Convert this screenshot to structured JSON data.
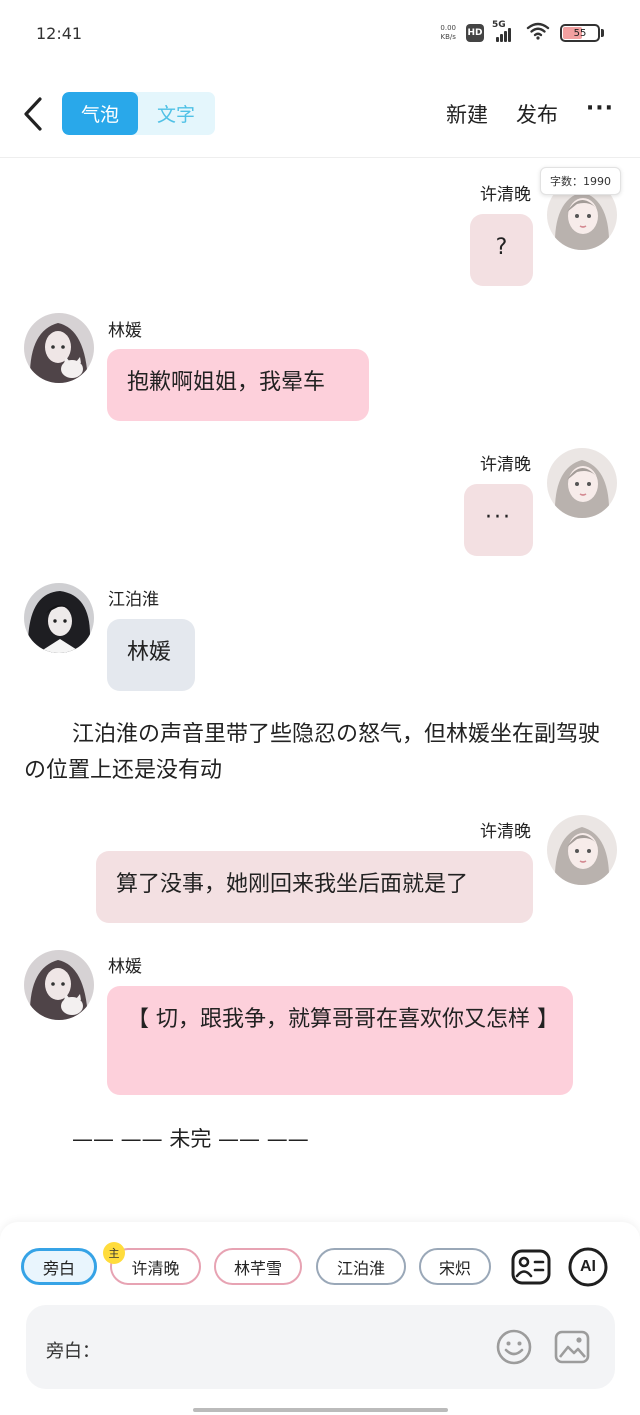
{
  "status_bar": {
    "time": "12:41",
    "net_speed_value": "0.00",
    "net_speed_unit": "KB/s",
    "hd_label": "HD",
    "signal_label": "5G",
    "battery_level": "55",
    "battery_fraction": 0.55
  },
  "header": {
    "tab_bubble": "气泡",
    "tab_text": "文字",
    "active_tab": "气泡",
    "new_label": "新建",
    "publish_label": "发布",
    "more_label": "···"
  },
  "word_count": "字数：1990",
  "messages": [
    {
      "speaker": "许清晚",
      "side": "right",
      "text": "?",
      "avatar": "female-avatar-icon"
    },
    {
      "speaker": "林媛",
      "side": "left",
      "text": "抱歉啊姐姐，我晕车",
      "avatar": "girl-with-cat-avatar-icon"
    },
    {
      "speaker": "许清晚",
      "side": "right",
      "text": "···",
      "avatar": "female-avatar-icon"
    },
    {
      "speaker": "江泊淮",
      "side": "left",
      "text": "林媛",
      "avatar": "dark-haired-male-avatar-icon"
    },
    {
      "speaker": "许清晚",
      "side": "right",
      "text": "算了没事，她刚回来我坐后面就是了",
      "avatar": "female-avatar-icon"
    },
    {
      "speaker": "林媛",
      "side": "left",
      "text": "【 切，跟我争，就算哥哥在喜欢你又怎样 】",
      "avatar": "girl-with-cat-avatar-icon"
    }
  ],
  "narration": "江泊淮の声音里带了些隐忍の怒气，但林媛坐在副驾驶の位置上还是没有动",
  "ending": "—— —— 未完 —— ——",
  "characters": [
    {
      "name": "旁白",
      "selected": true
    },
    {
      "name": "许清晚",
      "badge": "主"
    },
    {
      "name": "林芊雪"
    },
    {
      "name": "江泊淮"
    },
    {
      "name": "宋炽"
    }
  ],
  "tools": {
    "character_card_icon": "contact-card-icon",
    "ai_label": "AI"
  },
  "input": {
    "label": "旁白：",
    "value": "",
    "emoji_icon": "smiley-icon",
    "image_icon": "image-icon"
  },
  "colors": {
    "accent": "#29a8ea",
    "bubble_pink": "#fdd0db",
    "bubble_rose": "#f3e0e2",
    "bubble_gray": "#e4e8ee"
  }
}
